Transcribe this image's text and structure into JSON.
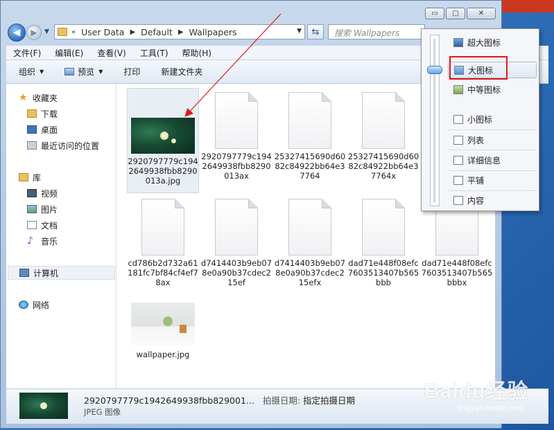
{
  "window": {
    "caption_buttons": {
      "minimize": "▭",
      "maximize": "▢",
      "close": "✕"
    }
  },
  "address": {
    "chevrons": "«",
    "crumbs": [
      "User Data",
      "Default",
      "Wallpapers"
    ],
    "search_placeholder": "搜索 Wallpapers"
  },
  "menu": [
    "文件(F)",
    "编辑(E)",
    "查看(V)",
    "工具(T)",
    "帮助(H)"
  ],
  "toolbar": {
    "organize": "组织",
    "preview": "预览",
    "print": "打印",
    "new_folder": "新建文件夹"
  },
  "nav": {
    "favorites": "收藏夹",
    "downloads": "下载",
    "desktop": "桌面",
    "recent": "最近访问的位置",
    "libraries": "库",
    "videos": "视频",
    "pictures": "图片",
    "documents": "文档",
    "music": "音乐",
    "computer": "计算机",
    "network": "网络"
  },
  "files": [
    {
      "name": "2920797779c1942649938fbb8290013a.jpg",
      "kind": "image-leaf"
    },
    {
      "name": "2920797779c1942649938fbb8290013ax",
      "kind": "doc"
    },
    {
      "name": "25327415690d6082c84922bb64e37764",
      "kind": "doc"
    },
    {
      "name": "25327415690d6082c84922bb64e37764x",
      "kind": "doc"
    },
    {
      "name": "cd786b2d732a61181fc7bf84cf4ef78ax",
      "kind": "doc"
    },
    {
      "name": "d7414403b9eb078e0a90b37cdec215ef",
      "kind": "doc"
    },
    {
      "name": "d7414403b9eb078e0a90b37cdec215efx",
      "kind": "doc"
    },
    {
      "name": "dad71e448f08efc7603513407b565bbb",
      "kind": "doc"
    },
    {
      "name": "dad71e448f08efc7603513407b565bbbx",
      "kind": "doc"
    },
    {
      "name": "wallpaper.jpg",
      "kind": "image-room"
    }
  ],
  "details": {
    "filename": "2920797779c1942649938fbb829001...",
    "date_label": "拍摄日期:",
    "date_value": "指定拍摄日期",
    "type": "JPEG 图像"
  },
  "view_menu": {
    "items": [
      "超大图标",
      "大图标",
      "中等图标",
      "小图标",
      "列表",
      "详细信息",
      "平铺",
      "内容"
    ],
    "selected": "大图标"
  },
  "watermark": {
    "brand": "Baidu经验",
    "url": "jingyan.baidu.com"
  },
  "colors": {
    "annotation": "#e0191b",
    "selection": "#dfe8f3"
  }
}
